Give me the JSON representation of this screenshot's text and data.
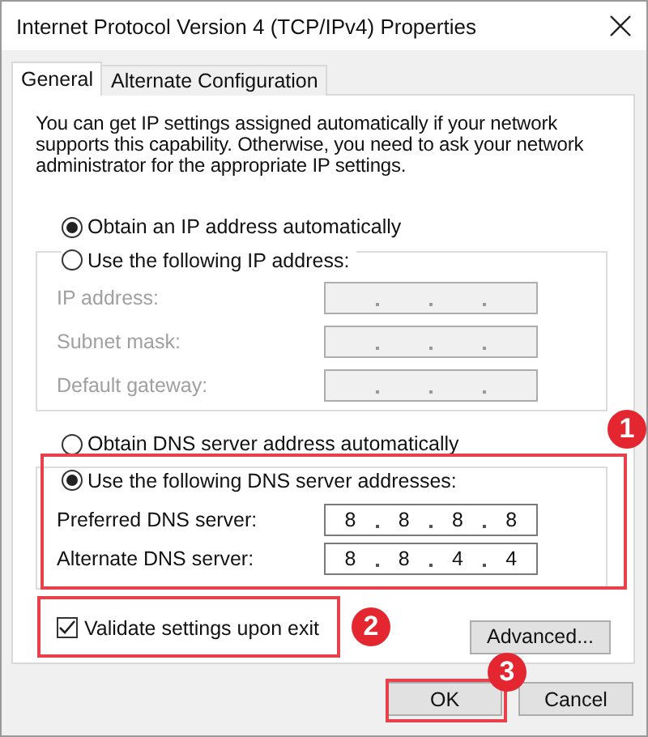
{
  "window": {
    "title": "Internet Protocol Version 4 (TCP/IPv4) Properties"
  },
  "tabs": [
    {
      "label": "General",
      "selected": true
    },
    {
      "label": "Alternate Configuration",
      "selected": false
    }
  ],
  "description": "You can get IP settings assigned automatically if your network supports this capability. Otherwise, you need to ask your network administrator for the appropriate IP settings.",
  "ip_mode": [
    {
      "label": "Obtain an IP address automatically",
      "selected": true
    },
    {
      "label": "Use the following IP address:",
      "selected": false
    }
  ],
  "ip_fields": [
    {
      "label": "IP address:",
      "disabled": true
    },
    {
      "label": "Subnet mask:",
      "disabled": true
    },
    {
      "label": "Default gateway:",
      "disabled": true
    }
  ],
  "dns_mode": [
    {
      "label": "Obtain DNS server address automatically",
      "selected": false
    },
    {
      "label": "Use the following DNS server addresses:",
      "selected": true
    }
  ],
  "dns_fields": [
    {
      "label": "Preferred DNS server:",
      "disabled": false,
      "octets": [
        "8",
        "8",
        "8",
        "8"
      ]
    },
    {
      "label": "Alternate DNS server:",
      "disabled": false,
      "octets": [
        "8",
        "8",
        "4",
        "4"
      ]
    }
  ],
  "validate": {
    "label": "Validate settings upon exit",
    "checked": true
  },
  "buttons": [
    {
      "label": "Advanced...",
      "kind": "advanced"
    },
    {
      "label": "OK",
      "kind": "ok"
    },
    {
      "label": "Cancel",
      "kind": "cancel"
    }
  ],
  "annotations": [
    {
      "number": "1",
      "kind": "dns"
    },
    {
      "number": "2",
      "kind": "validate"
    },
    {
      "number": "3",
      "kind": "ok"
    }
  ]
}
